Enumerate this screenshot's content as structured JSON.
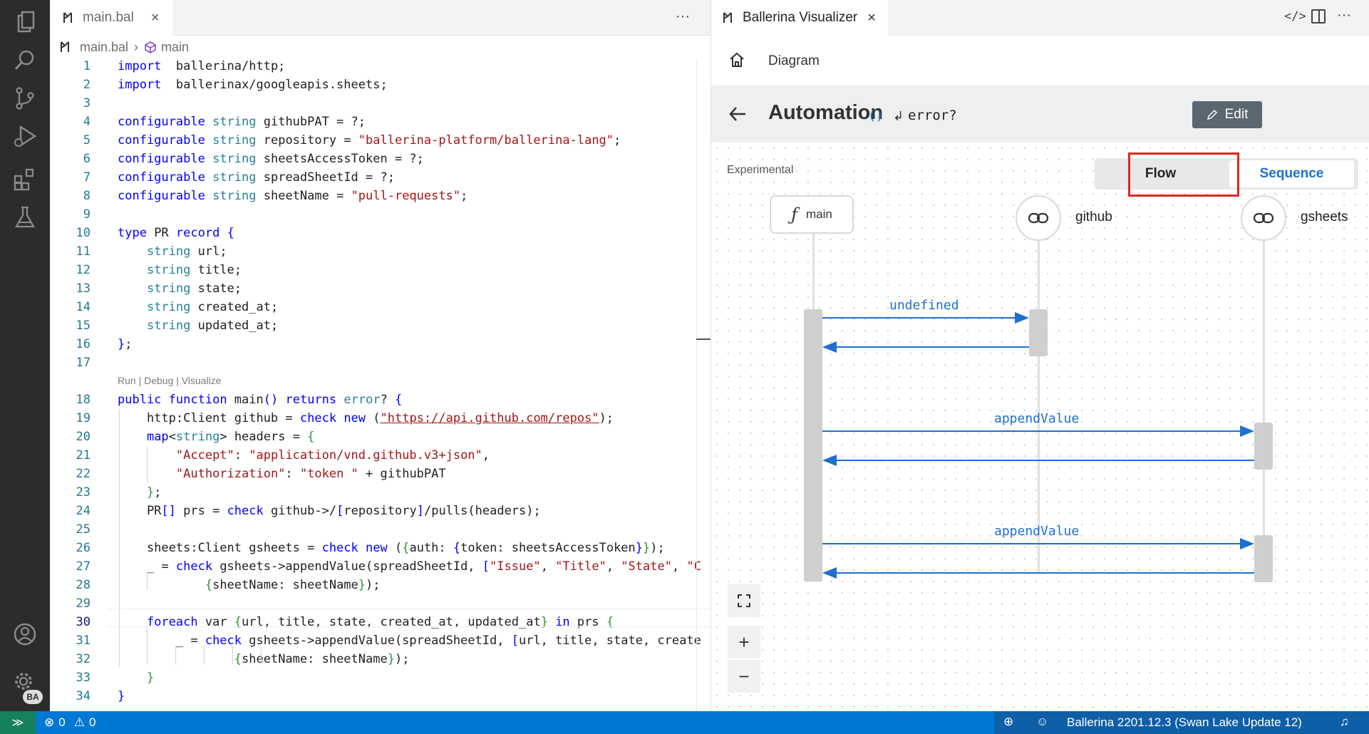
{
  "editor": {
    "tab_title": "main.bal",
    "tab_menu": "···",
    "breadcrumb": {
      "file": "main.bal",
      "symbol": "main"
    },
    "codelens": "Run | Debug | Visualize",
    "lines": [
      {
        "n": "1"
      },
      {
        "n": "2"
      },
      {
        "n": "3"
      },
      {
        "n": "4"
      },
      {
        "n": "5"
      },
      {
        "n": "6"
      },
      {
        "n": "7"
      },
      {
        "n": "8"
      },
      {
        "n": "9"
      },
      {
        "n": "10"
      },
      {
        "n": "11"
      },
      {
        "n": "12"
      },
      {
        "n": "13"
      },
      {
        "n": "14"
      },
      {
        "n": "15"
      },
      {
        "n": "16"
      },
      {
        "n": "17"
      },
      {
        "n": "18"
      },
      {
        "n": "19"
      },
      {
        "n": "20"
      },
      {
        "n": "21"
      },
      {
        "n": "22"
      },
      {
        "n": "23"
      },
      {
        "n": "24"
      },
      {
        "n": "25"
      },
      {
        "n": "26"
      },
      {
        "n": "27"
      },
      {
        "n": "28"
      },
      {
        "n": "29"
      },
      {
        "n": "30"
      },
      {
        "n": "31"
      },
      {
        "n": "32"
      },
      {
        "n": "33"
      },
      {
        "n": "34"
      }
    ],
    "code": {
      "l1": [
        [
          "kw",
          "import"
        ],
        [
          "",
          "  ballerina/http;"
        ]
      ],
      "l2": [
        [
          "kw",
          "import"
        ],
        [
          "",
          "  ballerinax/googleapis.sheets;"
        ]
      ],
      "l4": [
        [
          "kw",
          "configurable"
        ],
        [
          "",
          " "
        ],
        [
          "ty",
          "string"
        ],
        [
          "",
          " githubPAT = ?;"
        ]
      ],
      "l5": [
        [
          "kw",
          "configurable"
        ],
        [
          "",
          " "
        ],
        [
          "ty",
          "string"
        ],
        [
          "",
          " repository = "
        ],
        [
          "st",
          "\"ballerina-platform/ballerina-lang\""
        ],
        [
          "",
          ";"
        ]
      ],
      "l6": [
        [
          "kw",
          "configurable"
        ],
        [
          "",
          " "
        ],
        [
          "ty",
          "string"
        ],
        [
          "",
          " sheetsAccessToken = ?;"
        ]
      ],
      "l7": [
        [
          "kw",
          "configurable"
        ],
        [
          "",
          " "
        ],
        [
          "ty",
          "string"
        ],
        [
          "",
          " spreadSheetId = ?;"
        ]
      ],
      "l8": [
        [
          "kw",
          "configurable"
        ],
        [
          "",
          " "
        ],
        [
          "ty",
          "string"
        ],
        [
          "",
          " sheetName = "
        ],
        [
          "st",
          "\"pull-requests\""
        ],
        [
          "",
          ";"
        ]
      ],
      "l10": [
        [
          "kw",
          "type"
        ],
        [
          "",
          " PR "
        ],
        [
          "kw",
          "record"
        ],
        [
          "",
          " "
        ],
        [
          "kw",
          "{"
        ]
      ],
      "l11": [
        [
          "",
          "    "
        ],
        [
          "ty",
          "string"
        ],
        [
          "",
          " url;"
        ]
      ],
      "l12": [
        [
          "",
          "    "
        ],
        [
          "ty",
          "string"
        ],
        [
          "",
          " title;"
        ]
      ],
      "l13": [
        [
          "",
          "    "
        ],
        [
          "ty",
          "string"
        ],
        [
          "",
          " state;"
        ]
      ],
      "l14": [
        [
          "",
          "    "
        ],
        [
          "ty",
          "string"
        ],
        [
          "",
          " created_at;"
        ]
      ],
      "l15": [
        [
          "",
          "    "
        ],
        [
          "ty",
          "string"
        ],
        [
          "",
          " updated_at;"
        ]
      ],
      "l16": [
        [
          "kw",
          "}"
        ],
        [
          "",
          ";"
        ]
      ],
      "l18": [
        [
          "kw",
          "public"
        ],
        [
          "",
          " "
        ],
        [
          "kw",
          "function"
        ],
        [
          "",
          " main"
        ],
        [
          "kw",
          "()"
        ],
        [
          "",
          " "
        ],
        [
          "kw",
          "returns"
        ],
        [
          "",
          " "
        ],
        [
          "ty",
          "error"
        ],
        [
          "",
          "? "
        ],
        [
          "kw",
          "{"
        ]
      ],
      "l19": [
        [
          "",
          "    http:Client github = "
        ],
        [
          "kw",
          "check"
        ],
        [
          "",
          " "
        ],
        [
          "kw",
          "new"
        ],
        [
          "",
          " ("
        ],
        [
          "st",
          "\"https://api.github.com/repos\""
        ],
        [
          "",
          ");"
        ]
      ],
      "l20": [
        [
          "",
          "    "
        ],
        [
          "kw",
          "map"
        ],
        [
          "",
          "<"
        ],
        [
          "ty",
          "string"
        ],
        [
          "",
          "> headers = "
        ],
        [
          "br",
          "{"
        ]
      ],
      "l21": [
        [
          "",
          "        "
        ],
        [
          "st",
          "\"Accept\""
        ],
        [
          "",
          ": "
        ],
        [
          "st",
          "\"application/vnd.github.v3+json\""
        ],
        [
          "",
          ","
        ]
      ],
      "l22": [
        [
          "",
          "        "
        ],
        [
          "st",
          "\"Authorization\""
        ],
        [
          "",
          ": "
        ],
        [
          "st",
          "\"token \""
        ],
        [
          "",
          " + githubPAT"
        ]
      ],
      "l23": [
        [
          "",
          "    "
        ],
        [
          "br",
          "}"
        ],
        [
          "",
          ";"
        ]
      ],
      "l24": [
        [
          "",
          "    PR"
        ],
        [
          "kw",
          "[]"
        ],
        [
          "",
          " prs = "
        ],
        [
          "kw",
          "check"
        ],
        [
          "",
          " github->/"
        ],
        [
          "kw",
          "["
        ],
        [
          "",
          "repository"
        ],
        [
          "kw",
          "]"
        ],
        [
          "",
          "/pulls("
        ],
        [
          "",
          "headers"
        ],
        [
          "",
          ");"
        ]
      ],
      "l26": [
        [
          "",
          "    sheets:Client gsheets = "
        ],
        [
          "kw",
          "check"
        ],
        [
          "",
          " "
        ],
        [
          "kw",
          "new"
        ],
        [
          "",
          " ("
        ],
        [
          "br",
          "{"
        ],
        [
          "",
          "auth: "
        ],
        [
          "kw",
          "{"
        ],
        [
          "",
          "token: sheetsAccessToken"
        ],
        [
          "kw",
          "}"
        ],
        [
          "br",
          "}"
        ],
        [
          "",
          ");"
        ]
      ],
      "l27": [
        [
          "",
          "    _ = "
        ],
        [
          "kw",
          "check"
        ],
        [
          "",
          " gsheets->appendValue(spreadSheetId, "
        ],
        [
          "kw",
          "["
        ],
        [
          "st",
          "\"Issue\""
        ],
        [
          "",
          ", "
        ],
        [
          "st",
          "\"Title\""
        ],
        [
          "",
          ", "
        ],
        [
          "st",
          "\"State\""
        ],
        [
          "",
          ", "
        ],
        [
          "st",
          "\"C"
        ]
      ],
      "l28": [
        [
          "",
          "            "
        ],
        [
          "br",
          "{"
        ],
        [
          "",
          "sheetName: sheetName"
        ],
        [
          "br",
          "}"
        ],
        [
          "",
          ");"
        ]
      ],
      "l30": [
        [
          "",
          "    "
        ],
        [
          "kw",
          "foreach"
        ],
        [
          "",
          " var "
        ],
        [
          "br",
          "{"
        ],
        [
          "",
          "url, title, state, created_at, updated_at"
        ],
        [
          "br",
          "}"
        ],
        [
          "",
          " "
        ],
        [
          "kw",
          "in"
        ],
        [
          "",
          " prs "
        ],
        [
          "br",
          "{"
        ]
      ],
      "l31": [
        [
          "",
          "        _ = "
        ],
        [
          "kw",
          "check"
        ],
        [
          "",
          " gsheets->appendValue(spreadSheetId, "
        ],
        [
          "kw",
          "["
        ],
        [
          "",
          "url, title, state, create"
        ]
      ],
      "l32": [
        [
          "",
          "                "
        ],
        [
          "br",
          "{"
        ],
        [
          "",
          "sheetName: sheetName"
        ],
        [
          "br",
          "}"
        ],
        [
          "",
          ");"
        ]
      ],
      "l33": [
        [
          "",
          "    "
        ],
        [
          "br",
          "}"
        ]
      ],
      "l34": [
        [
          "kw",
          "}"
        ]
      ]
    }
  },
  "visualizer": {
    "tab_title": "Ballerina Visualizer",
    "header_label": "Diagram",
    "function_name": "Automation",
    "params": "()",
    "return_arrow": "↲",
    "return_type": "error?",
    "edit_label": "Edit",
    "experimental_label": "Experimental",
    "toggle": {
      "flow": "Flow",
      "sequence": "Sequence",
      "selected": "Sequence"
    },
    "participants": [
      {
        "name": "main",
        "kind": "function"
      },
      {
        "name": "github",
        "kind": "connection"
      },
      {
        "name": "gsheets",
        "kind": "connection"
      }
    ],
    "messages": [
      {
        "from": "main",
        "to": "github",
        "label": "undefined"
      },
      {
        "from": "main",
        "to": "gsheets",
        "label": "appendValue"
      },
      {
        "from": "main",
        "to": "gsheets",
        "label": "appendValue"
      }
    ],
    "highlight_color": "#e0281e",
    "accent_color": "#1f6fce"
  },
  "status": {
    "errors": "0",
    "warnings": "0",
    "version": "Ballerina 2201.12.3 (Swan Lake Update 12)"
  },
  "activity": {
    "icons": [
      "files-icon",
      "search-icon",
      "source-control-icon",
      "run-debug-icon",
      "extensions-icon",
      "testing-icon",
      "account-icon",
      "settings-icon"
    ],
    "settings_badge": "BA"
  }
}
